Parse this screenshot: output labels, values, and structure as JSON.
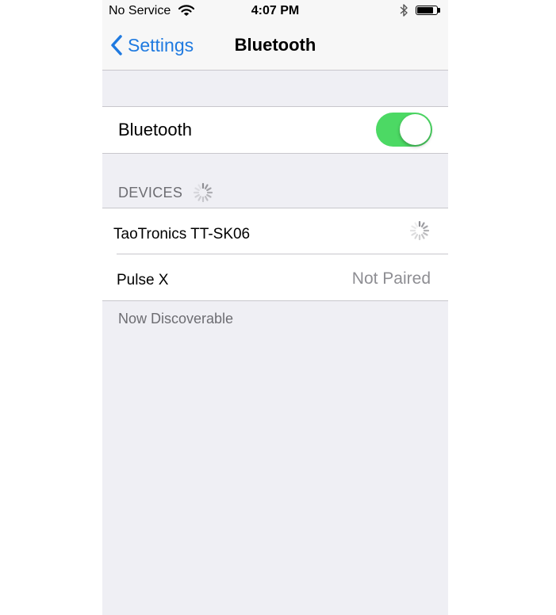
{
  "status_bar": {
    "carrier": "No Service",
    "time": "4:07 PM",
    "wifi_icon": "wifi-icon",
    "bluetooth_icon": "bluetooth-icon",
    "battery_level": 0.85
  },
  "nav": {
    "back_label": "Settings",
    "title": "Bluetooth"
  },
  "bluetooth_toggle": {
    "label": "Bluetooth",
    "on": true,
    "on_color": "#4cd964"
  },
  "devices": {
    "header": "DEVICES",
    "items": [
      {
        "name": "TaoTronics TT-SK06",
        "status": "",
        "connecting": true
      },
      {
        "name": "Pulse X",
        "status": "Not Paired",
        "connecting": false
      }
    ]
  },
  "footer": "Now Discoverable",
  "colors": {
    "accent": "#1f7ae0",
    "background": "#efeff4",
    "secondary_text": "#8e8e93"
  }
}
